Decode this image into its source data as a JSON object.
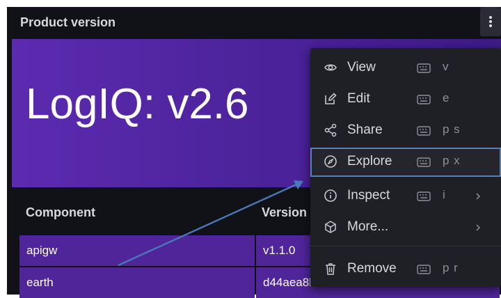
{
  "panel": {
    "title": "Product version",
    "banner_text": "LogIQ: v2.6"
  },
  "table": {
    "headers": [
      "Component",
      "Version"
    ],
    "rows": [
      [
        "apigw",
        "v1.1.0"
      ],
      [
        "earth",
        "d44aea8b"
      ]
    ]
  },
  "context_menu": {
    "items": [
      {
        "label": "View",
        "shortcut": "v",
        "icon": "eye-icon"
      },
      {
        "label": "Edit",
        "shortcut": "e",
        "icon": "edit-icon"
      },
      {
        "label": "Share",
        "shortcut": "p s",
        "icon": "share-icon"
      },
      {
        "label": "Explore",
        "shortcut": "p x",
        "icon": "compass-icon",
        "selected": true
      },
      {
        "label": "Inspect",
        "shortcut": "i",
        "icon": "info-icon",
        "submenu": true
      },
      {
        "label": "More...",
        "shortcut": "",
        "icon": "cube-icon",
        "submenu": true
      },
      {
        "label": "Remove",
        "shortcut": "p r",
        "icon": "trash-icon"
      }
    ]
  },
  "colors": {
    "panel_bg": "#111217",
    "banner": "#4f2599",
    "menu_bg": "#1f2026",
    "highlight": "#5b7fb0",
    "annotation_arrow": "#4a78b8"
  }
}
